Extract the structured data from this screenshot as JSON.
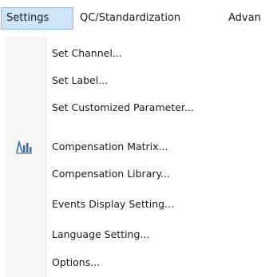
{
  "menubar": {
    "items": [
      {
        "label": "Settings",
        "active": true
      },
      {
        "label": "QC/Standardization",
        "active": false
      },
      {
        "label": "Advan",
        "active": false
      }
    ]
  },
  "dropdown": {
    "items": [
      {
        "label": "Set Channel..."
      },
      {
        "label": "Set Label..."
      },
      {
        "label": "Set Customized Parameter..."
      },
      {
        "label": "Compensation Matrix...",
        "icon": "compensation-matrix-icon"
      },
      {
        "label": "Compensation Library..."
      },
      {
        "label": "Events Display Setting..."
      },
      {
        "label": "Language Setting..."
      },
      {
        "label": "Options..."
      }
    ]
  },
  "colors": {
    "active_menu_bg": "#cfe4f6",
    "active_menu_border": "#8fb8dc",
    "icon_gutter": "#f6f6f6",
    "icon_blue": "#2f6fb5"
  }
}
